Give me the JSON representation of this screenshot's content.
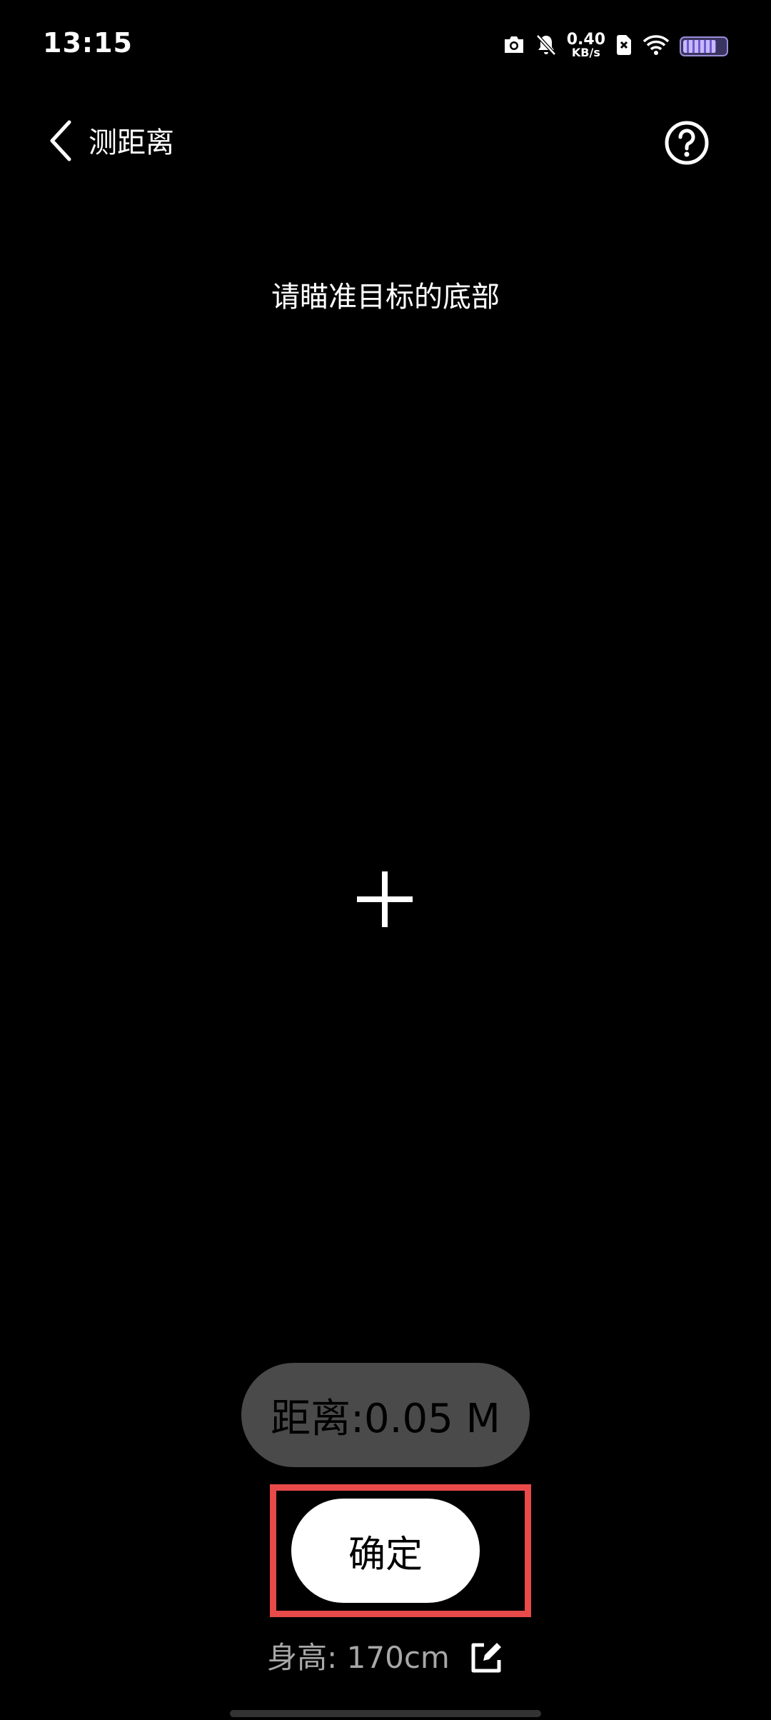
{
  "status_bar": {
    "time": "13:15",
    "net_speed_value": "0.40",
    "net_speed_unit": "KB/s",
    "battery_level": 0.8,
    "icons": [
      "camera-icon",
      "bell-muted-icon",
      "sim-blocked-icon",
      "wifi-icon",
      "battery-icon"
    ]
  },
  "header": {
    "title": "测距离",
    "back_icon": "chevron-left-icon",
    "help_icon": "help-circle-icon"
  },
  "instruction": "请瞄准目标的底部",
  "readout": {
    "distance": "距离:0.05 M"
  },
  "actions": {
    "confirm_label": "确定",
    "highlight_color": "#e84a4a"
  },
  "height": {
    "label": "身高: 170cm",
    "edit_icon": "edit-icon"
  },
  "colors": {
    "background": "#000000",
    "pill": "#4a4a4a",
    "button": "#ffffff",
    "secondary_text": "#a8a8a8"
  }
}
